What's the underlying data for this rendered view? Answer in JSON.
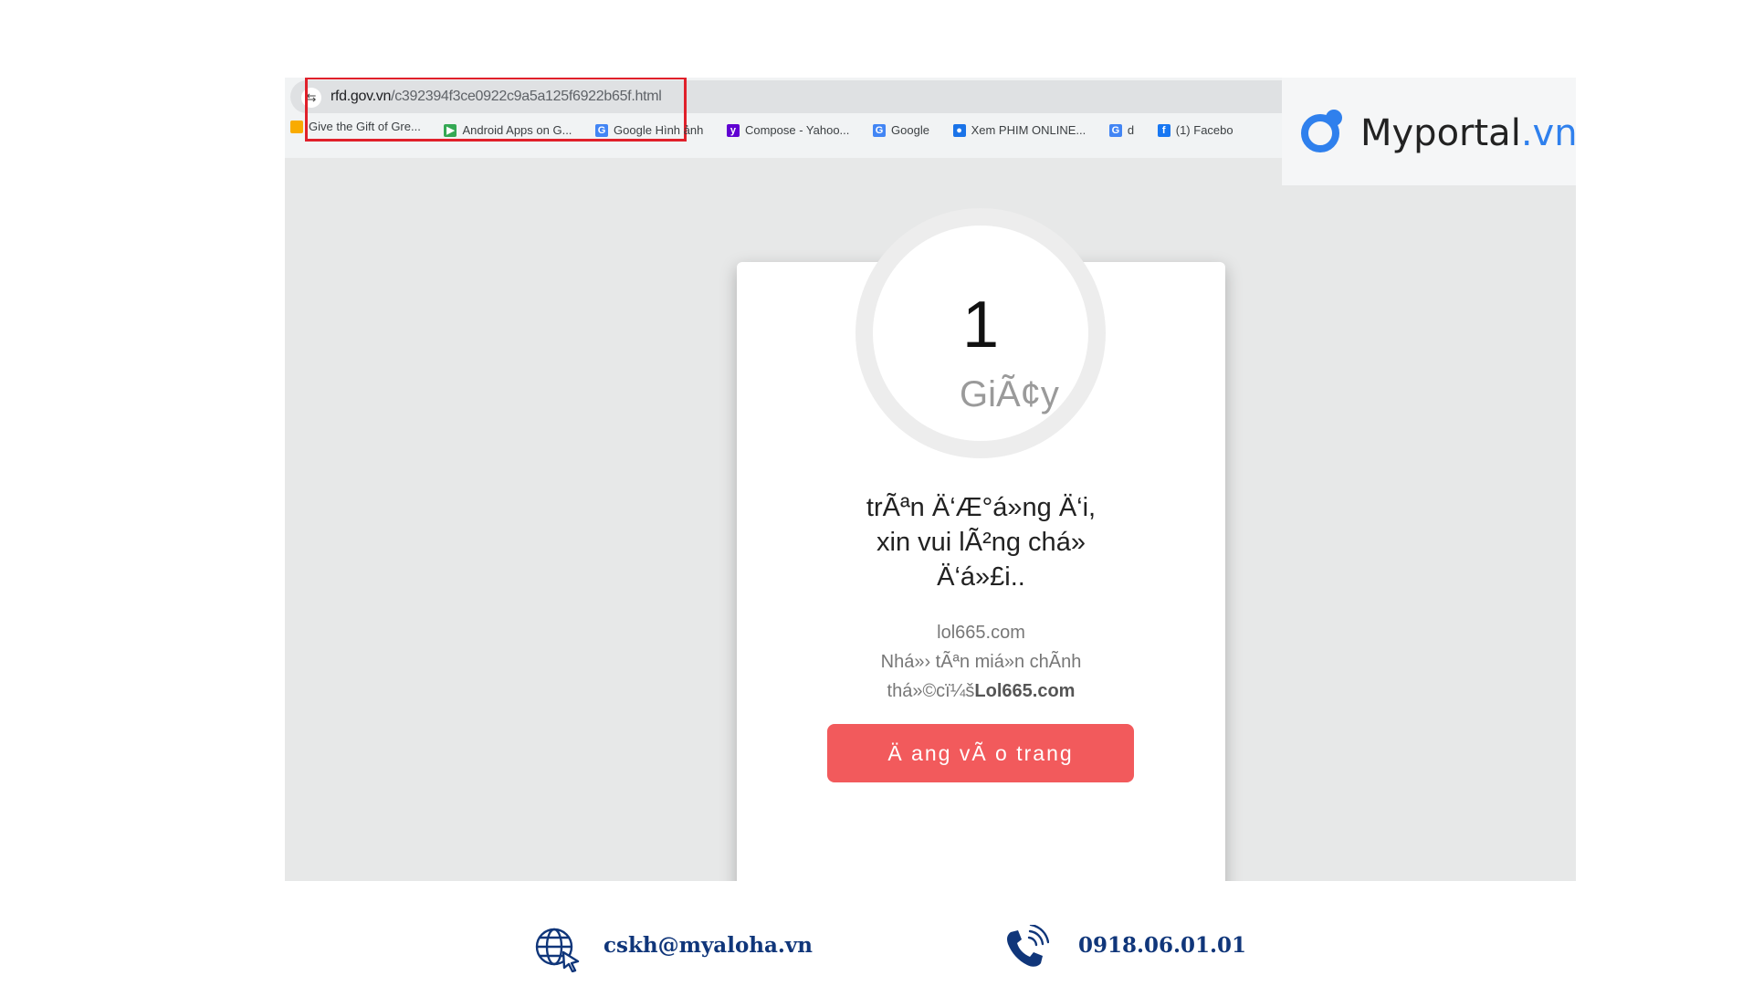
{
  "browser": {
    "url_host": "rfd.gov.vn",
    "url_path": "/c392394f3ce0922c9a5a125f6922b65f.html",
    "bookmarks": [
      {
        "label": "Give the Gift of Gre...",
        "icon": "bookmark-icon",
        "color": "#f9ab00"
      },
      {
        "label": "Android Apps on G...",
        "icon": "google-play-icon",
        "color": "#34a853"
      },
      {
        "label": "Google Hình ảnh",
        "icon": "google-icon",
        "color": "#4285f4"
      },
      {
        "label": "Compose - Yahoo...",
        "icon": "yahoo-icon",
        "color": "#6001d2"
      },
      {
        "label": "Google",
        "icon": "google-icon",
        "color": "#4285f4"
      },
      {
        "label": "Xem PHIM ONLINE...",
        "icon": "film-icon",
        "color": "#1a73e8"
      },
      {
        "label": "d",
        "icon": "google-icon",
        "color": "#4285f4"
      },
      {
        "label": "(1) Facebo",
        "icon": "facebook-icon",
        "color": "#1877f2"
      }
    ]
  },
  "page": {
    "timer_value": "1",
    "timer_unit": "GiÃ¢y",
    "title_lines": [
      "trÃªn Ä‘Æ°á»ng Ä‘i,",
      "xin vui lÃ²ng chá»",
      "Ä‘á»£i.."
    ],
    "site": "lol665.com",
    "sub_line": "Nhá»› tÃªn miá»n chÃnh",
    "sub_prefix": "thá»©cï¼š",
    "sub_bold": "Lol665.com",
    "button_label": "Ä ang vÃ o trang",
    "button_color": "#f25a5c"
  },
  "logo": {
    "name": "Myportal",
    "suffix": ".vn",
    "accent": "#2f80ed"
  },
  "footer": {
    "email": "cskh@myaloha.vn",
    "phone": "0918.06.01.01",
    "text_color": "#10367a"
  }
}
